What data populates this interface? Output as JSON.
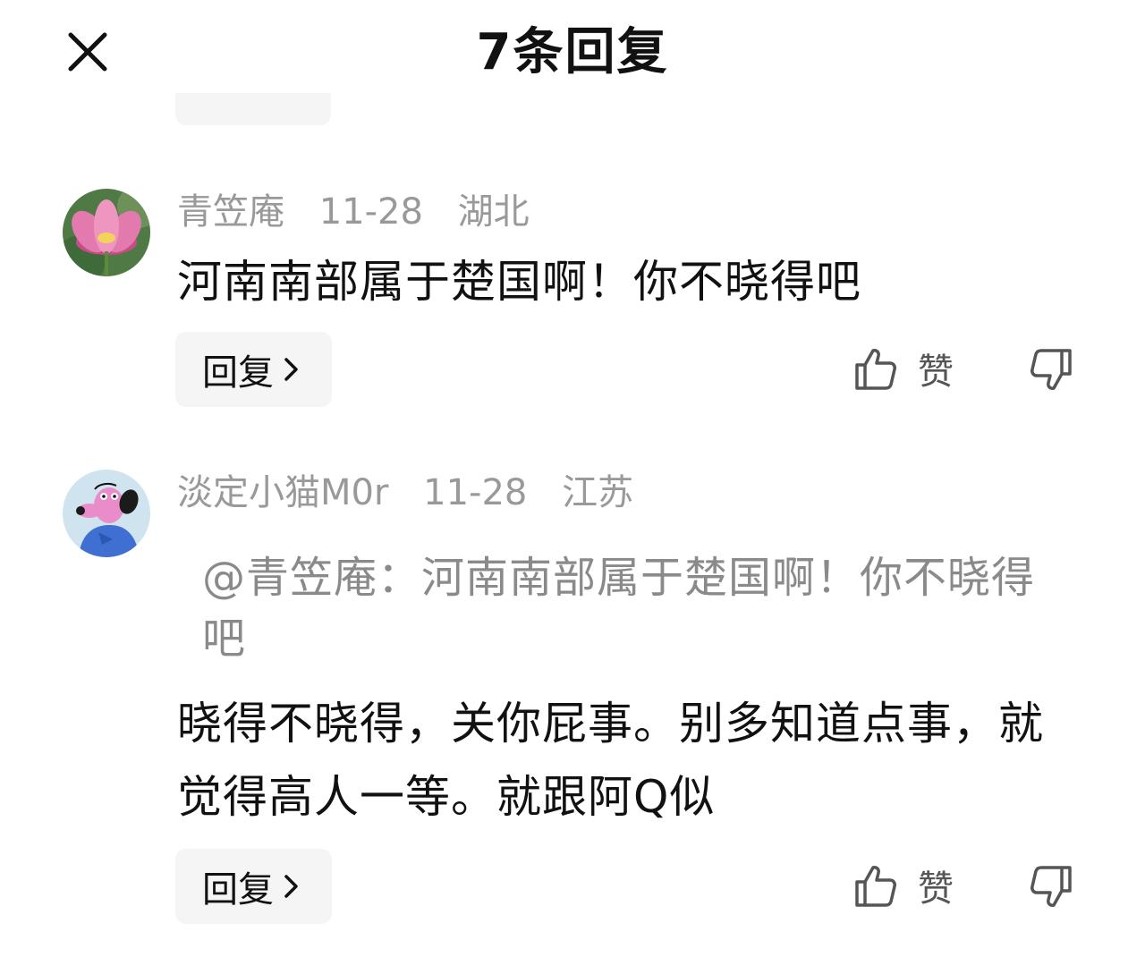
{
  "header": {
    "title": "7条回复",
    "close_icon": "close-icon"
  },
  "comments": [
    {
      "username": "青笠庵",
      "date": "11-28",
      "location": "湖北",
      "quote": "",
      "text": "河南南部属于楚国啊！你不晓得吧",
      "reply_label": "回复",
      "like_label": "赞",
      "avatar": "lotus-avatar"
    },
    {
      "username": "淡定小猫M0r",
      "date": "11-28",
      "location": "江苏",
      "quote": "@青笠庵：河南南部属于楚国啊！你不晓得吧",
      "text": "晓得不晓得，关你屁事。别多知道点事，就觉得高人一等。就跟阿Q似",
      "reply_label": "回复",
      "like_label": "赞",
      "avatar": "cartoon-dog-avatar"
    }
  ],
  "colors": {
    "meta_text": "#999999",
    "quote_text": "#8a8a8a",
    "button_bg": "#f5f5f5"
  }
}
